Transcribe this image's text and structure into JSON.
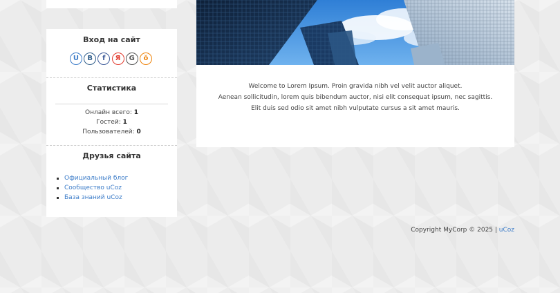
{
  "sidebar": {
    "login": {
      "title": "Вход на сайт",
      "social": [
        {
          "name": "ucoz",
          "glyph": "U",
          "color": "#3a7bc8"
        },
        {
          "name": "vkontakte",
          "glyph": "B",
          "color": "#2f5d8a"
        },
        {
          "name": "facebook",
          "glyph": "f",
          "color": "#3b5998"
        },
        {
          "name": "yandex",
          "glyph": "Я",
          "color": "#e23a2e"
        },
        {
          "name": "google",
          "glyph": "G",
          "color": "#555555"
        },
        {
          "name": "odnoklassniki",
          "glyph": "ŏ",
          "color": "#ee8208"
        }
      ]
    },
    "stats": {
      "title": "Статистика",
      "online_label": "Онлайн всего: ",
      "online_value": "1",
      "guests_label": "Гостей: ",
      "guests_value": "1",
      "users_label": "Пользователей: ",
      "users_value": "0"
    },
    "friends": {
      "title": "Друзья сайта",
      "links": [
        "Официальный блог",
        "Сообщество uCoz",
        "База знаний uCoz"
      ]
    }
  },
  "main": {
    "hero_alt": "",
    "welcome": [
      "Welcome to Lorem Ipsum. Proin gravida nibh vel velit auctor aliquet.",
      "Aenean sollicitudin, lorem quis bibendum auctor, nisi elit consequat ipsum, nec sagittis.",
      "Elit duis sed odio sit amet nibh vulputate cursus a sit amet mauris."
    ]
  },
  "footer": {
    "copyright": "Copyright MyCorp © 2025 | ",
    "link": "uCoz"
  },
  "colors": {
    "link": "#3a7bc8",
    "page_bg": "#ececec",
    "sky": "#4b8fd8"
  }
}
